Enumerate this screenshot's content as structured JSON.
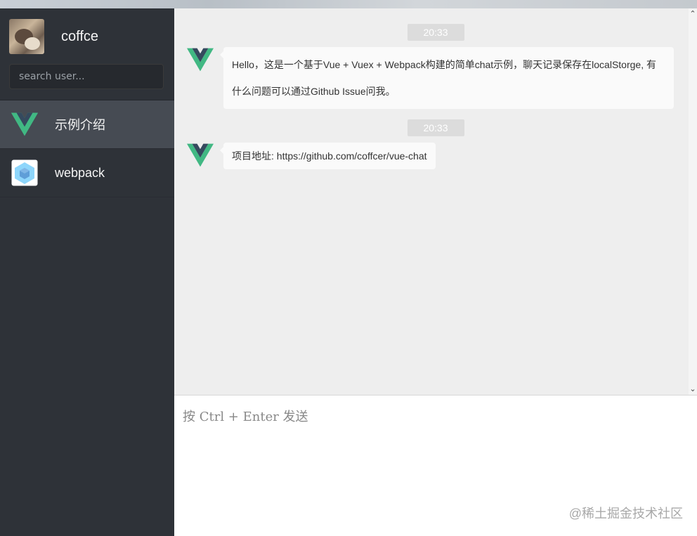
{
  "user": {
    "name": "coffce"
  },
  "search": {
    "placeholder": "search user..."
  },
  "sessions": [
    {
      "name": "示例介绍",
      "icon": "vue-logo-icon",
      "active": true
    },
    {
      "name": "webpack",
      "icon": "webpack-cube-icon",
      "active": false
    }
  ],
  "messages": [
    {
      "time": "20:33",
      "text": "Hello，这是一个基于Vue + Vuex + Webpack构建的简单chat示例，聊天记录保存在localStorge, 有什么问题可以通过Github Issue问我。"
    },
    {
      "time": "20:33",
      "text": "项目地址: https://github.com/coffcer/vue-chat"
    }
  ],
  "composer": {
    "placeholder": "按 Ctrl + Enter 发送"
  },
  "watermark": "@稀土掘金技术社区",
  "colors": {
    "sidebar_bg": "#2e3238",
    "active_session_bg": "#464b53",
    "message_area_bg": "#eeeeee",
    "vue_green": "#41b883",
    "vue_dark": "#35495e",
    "webpack_blue": "#8ed6fb"
  }
}
